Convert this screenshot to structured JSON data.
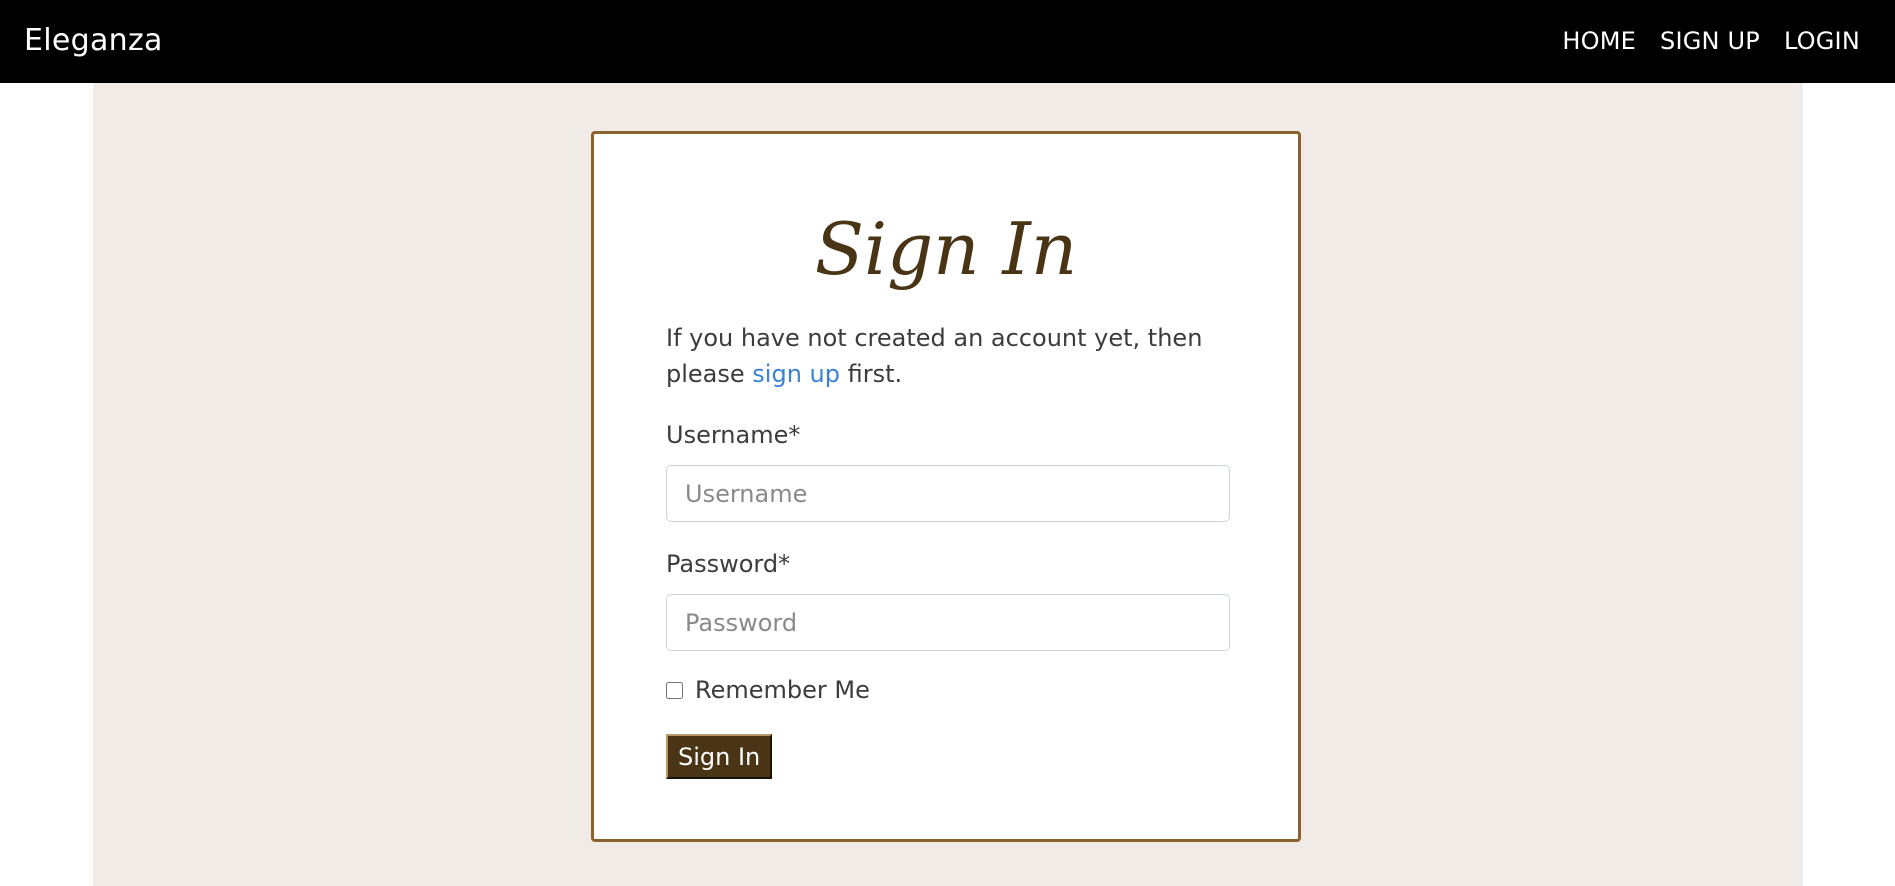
{
  "navbar": {
    "brand": "Eleganza",
    "links": [
      "HOME",
      "SIGN UP",
      "LOGIN"
    ]
  },
  "signin_card": {
    "title": "Sign In",
    "intro_before": "If you have not created an account yet, then please ",
    "intro_link": "sign up",
    "intro_after": " first.",
    "username_label": "Username*",
    "username_placeholder": "Username",
    "username_value": "",
    "password_label": "Password*",
    "password_placeholder": "Password",
    "password_value": "",
    "remember_label": "Remember Me",
    "remember_checked": false,
    "submit_label": "Sign In"
  },
  "colors": {
    "navbar_bg": "#000000",
    "page_bg": "#f0ebe7",
    "card_border": "#8b622e",
    "title_color": "#4a3416",
    "link_color": "#3b82d6",
    "button_bg": "#4a3416"
  }
}
